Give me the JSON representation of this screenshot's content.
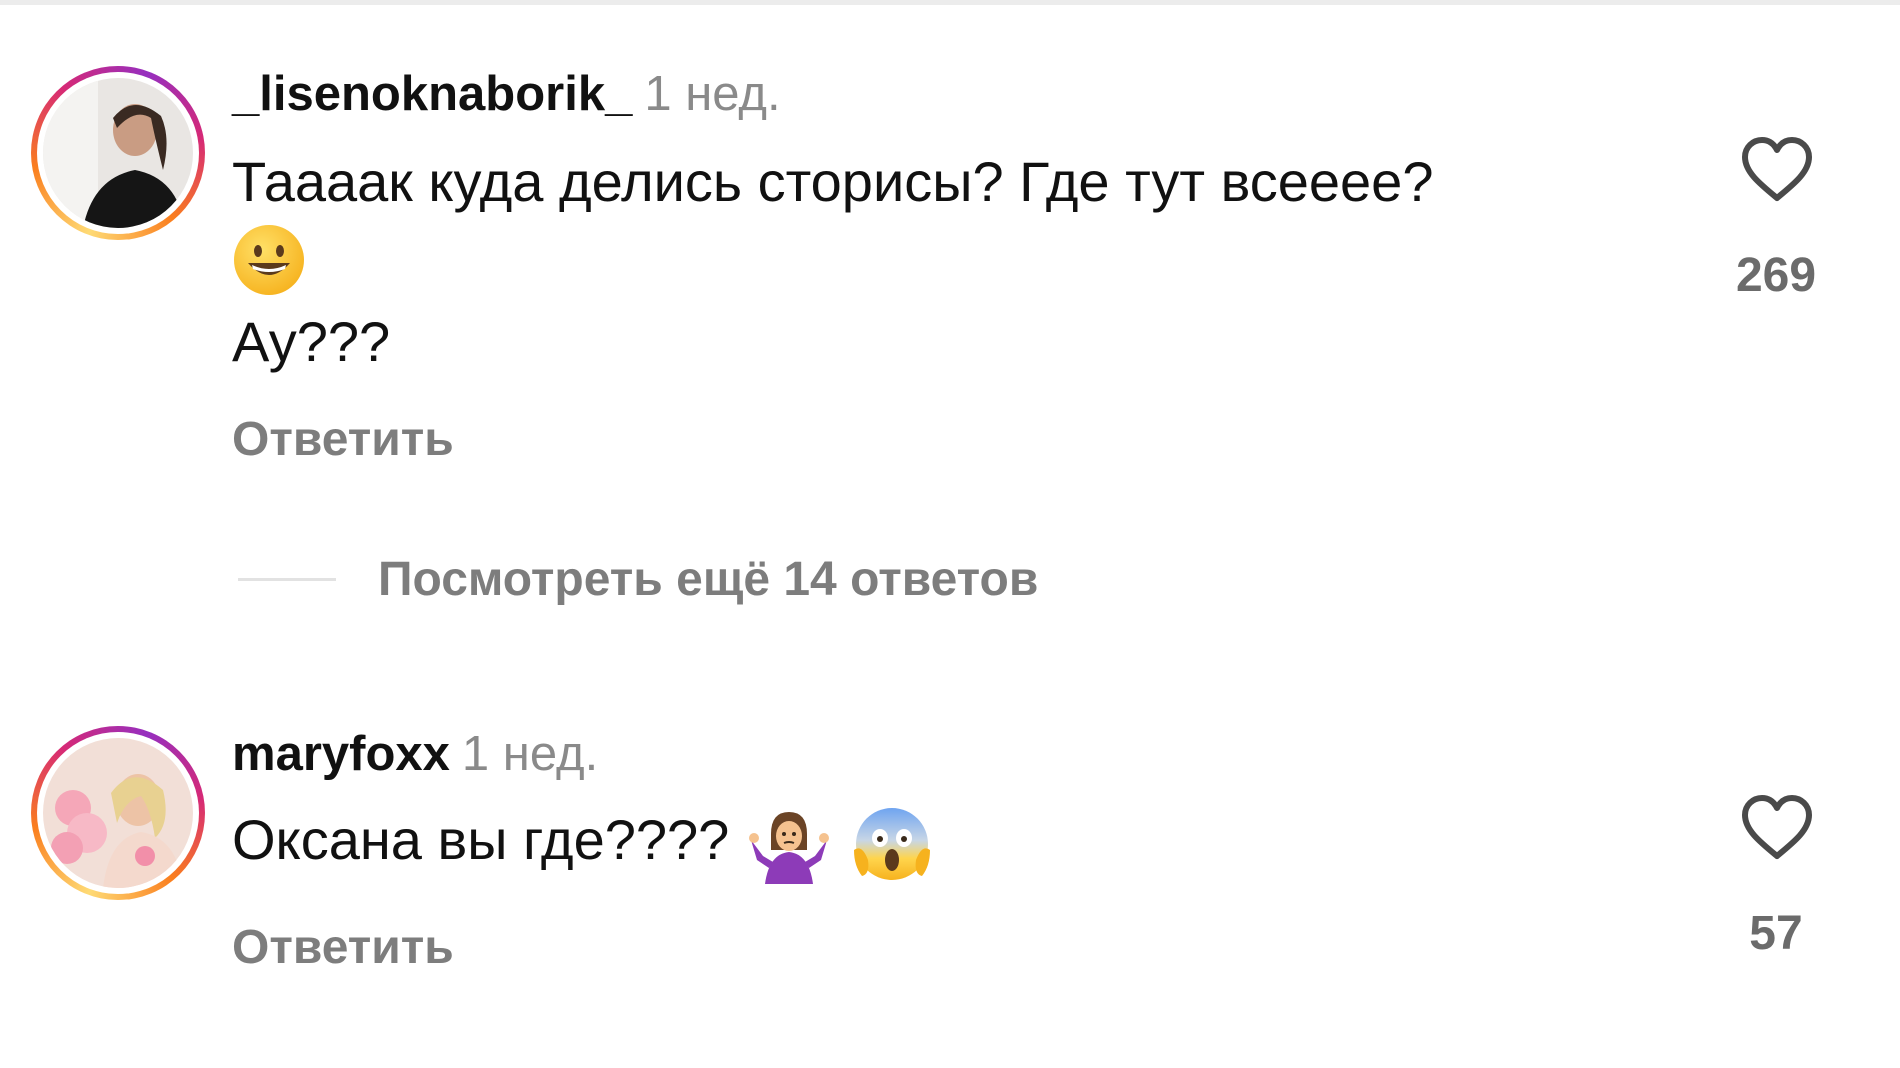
{
  "comments": [
    {
      "username": "_lisenoknaborik_",
      "time": "1 нед.",
      "text_line1": "Таааак куда делись сторисы? Где тут всееее?",
      "text_line2_emoji": "grinning-face-emoji",
      "text_line3": "Ау???",
      "reply_label": "Ответить",
      "likes": "269",
      "view_replies_label": "Посмотреть ещё 14 ответов"
    },
    {
      "username": "maryfoxx",
      "time": "1 нед.",
      "text": "Оксана вы где????",
      "text_emojis": [
        "woman-shrugging-emoji",
        "face-screaming-in-fear-emoji"
      ],
      "reply_label": "Ответить",
      "likes": "57"
    }
  ],
  "colors": {
    "text": "#111111",
    "secondary": "#7d7d7d",
    "time": "#8a8a8a",
    "likes": "#6b6b6b"
  }
}
